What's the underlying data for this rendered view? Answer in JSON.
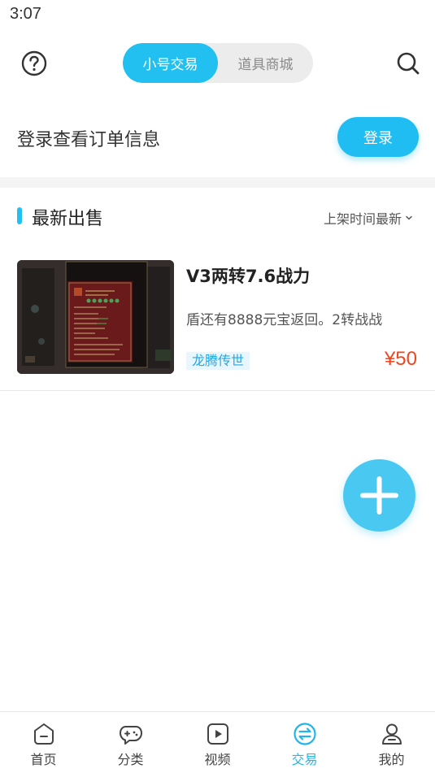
{
  "status_bar": {
    "time": "3:07"
  },
  "topbar": {
    "help_icon": "question-circle-icon",
    "search_icon": "search-icon",
    "segment_tabs": [
      {
        "label": "小号交易",
        "active": true
      },
      {
        "label": "道具商城",
        "active": false
      }
    ]
  },
  "login_prompt": {
    "text": "登录查看订单信息",
    "button_label": "登录"
  },
  "section": {
    "title": "最新出售",
    "sort_label": "上架时间最新"
  },
  "listings": [
    {
      "title": "V3两转7.6战力",
      "description": "盾还有8888元宝返回。2转战战",
      "game_tag": "龙腾传世",
      "price": "¥50"
    }
  ],
  "fab": {
    "icon": "plus-icon"
  },
  "tabbar": {
    "items": [
      {
        "label": "首页",
        "icon": "home-icon",
        "active": false
      },
      {
        "label": "分类",
        "icon": "gamepad-icon",
        "active": false
      },
      {
        "label": "视频",
        "icon": "video-icon",
        "active": false
      },
      {
        "label": "交易",
        "icon": "exchange-icon",
        "active": true
      },
      {
        "label": "我的",
        "icon": "profile-icon",
        "active": false
      }
    ]
  },
  "colors": {
    "accent": "#22c0f0",
    "price": "#f0451e",
    "tag_bg": "#e8f6fd",
    "tag_text": "#22a8e6"
  }
}
